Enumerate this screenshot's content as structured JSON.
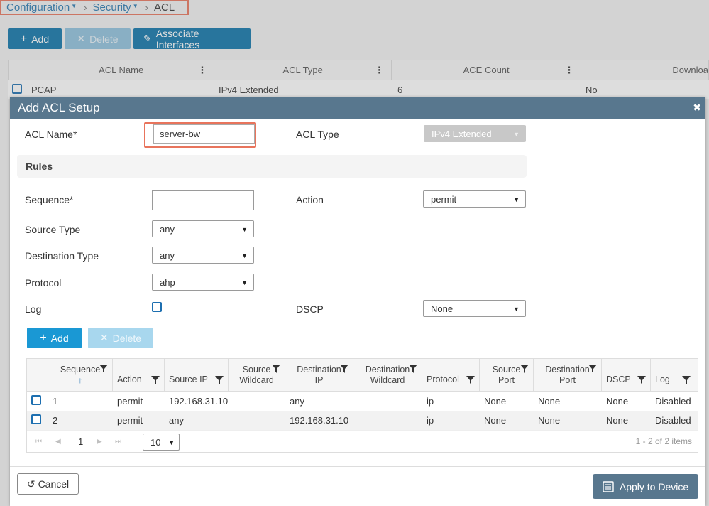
{
  "breadcrumb": {
    "items": [
      "Configuration",
      "Security"
    ],
    "current": "ACL"
  },
  "toolbar": {
    "add_label": "Add",
    "delete_label": "Delete",
    "associate_label": "Associate Interfaces"
  },
  "acl_table": {
    "columns": [
      "ACL Name",
      "ACL Type",
      "ACE Count",
      "Downloa"
    ],
    "row": {
      "name": "PCAP",
      "type": "IPv4 Extended",
      "count": "6",
      "download": "No"
    }
  },
  "modal": {
    "title": "Add ACL Setup",
    "acl_name_label": "ACL Name*",
    "acl_name_value": "server-bw",
    "acl_type_label": "ACL Type",
    "acl_type_value": "IPv4 Extended",
    "rules_heading": "Rules",
    "sequence_label": "Sequence*",
    "sequence_value": "",
    "action_label": "Action",
    "action_value": "permit",
    "source_type_label": "Source Type",
    "source_type_value": "any",
    "destination_type_label": "Destination Type",
    "destination_type_value": "any",
    "protocol_label": "Protocol",
    "protocol_value": "ahp",
    "log_label": "Log",
    "dscp_label": "DSCP",
    "dscp_value": "None",
    "add_rule_label": "Add",
    "delete_rule_label": "Delete",
    "cancel_label": "Cancel",
    "apply_label": "Apply to Device"
  },
  "rules_grid": {
    "headers": {
      "sequence": "Sequence",
      "action": "Action",
      "source_ip": "Source IP",
      "source_wildcard_1": "Source",
      "source_wildcard_2": "Wildcard",
      "destination_ip_1": "Destination",
      "destination_ip_2": "IP",
      "destination_wildcard_1": "Destination",
      "destination_wildcard_2": "Wildcard",
      "protocol": "Protocol",
      "source_port_1": "Source",
      "source_port_2": "Port",
      "destination_port_1": "Destination",
      "destination_port_2": "Port",
      "dscp": "DSCP",
      "log": "Log"
    },
    "rows": [
      {
        "sequence": "1",
        "action": "permit",
        "source_ip": "192.168.31.10",
        "source_wildcard": "",
        "destination_ip": "any",
        "destination_wildcard": "",
        "protocol": "ip",
        "source_port": "None",
        "destination_port": "None",
        "dscp": "None",
        "log": "Disabled"
      },
      {
        "sequence": "2",
        "action": "permit",
        "source_ip": "any",
        "source_wildcard": "",
        "destination_ip": "192.168.31.10",
        "destination_wildcard": "",
        "protocol": "ip",
        "source_port": "None",
        "destination_port": "None",
        "dscp": "None",
        "log": "Disabled"
      }
    ],
    "pager": {
      "current_page": "1",
      "page_size": "10",
      "summary": "1 - 2 of 2 items"
    }
  },
  "colors": {
    "primary": "#0e75aa",
    "modal_header": "#58778e",
    "highlight": "#e8745c"
  }
}
